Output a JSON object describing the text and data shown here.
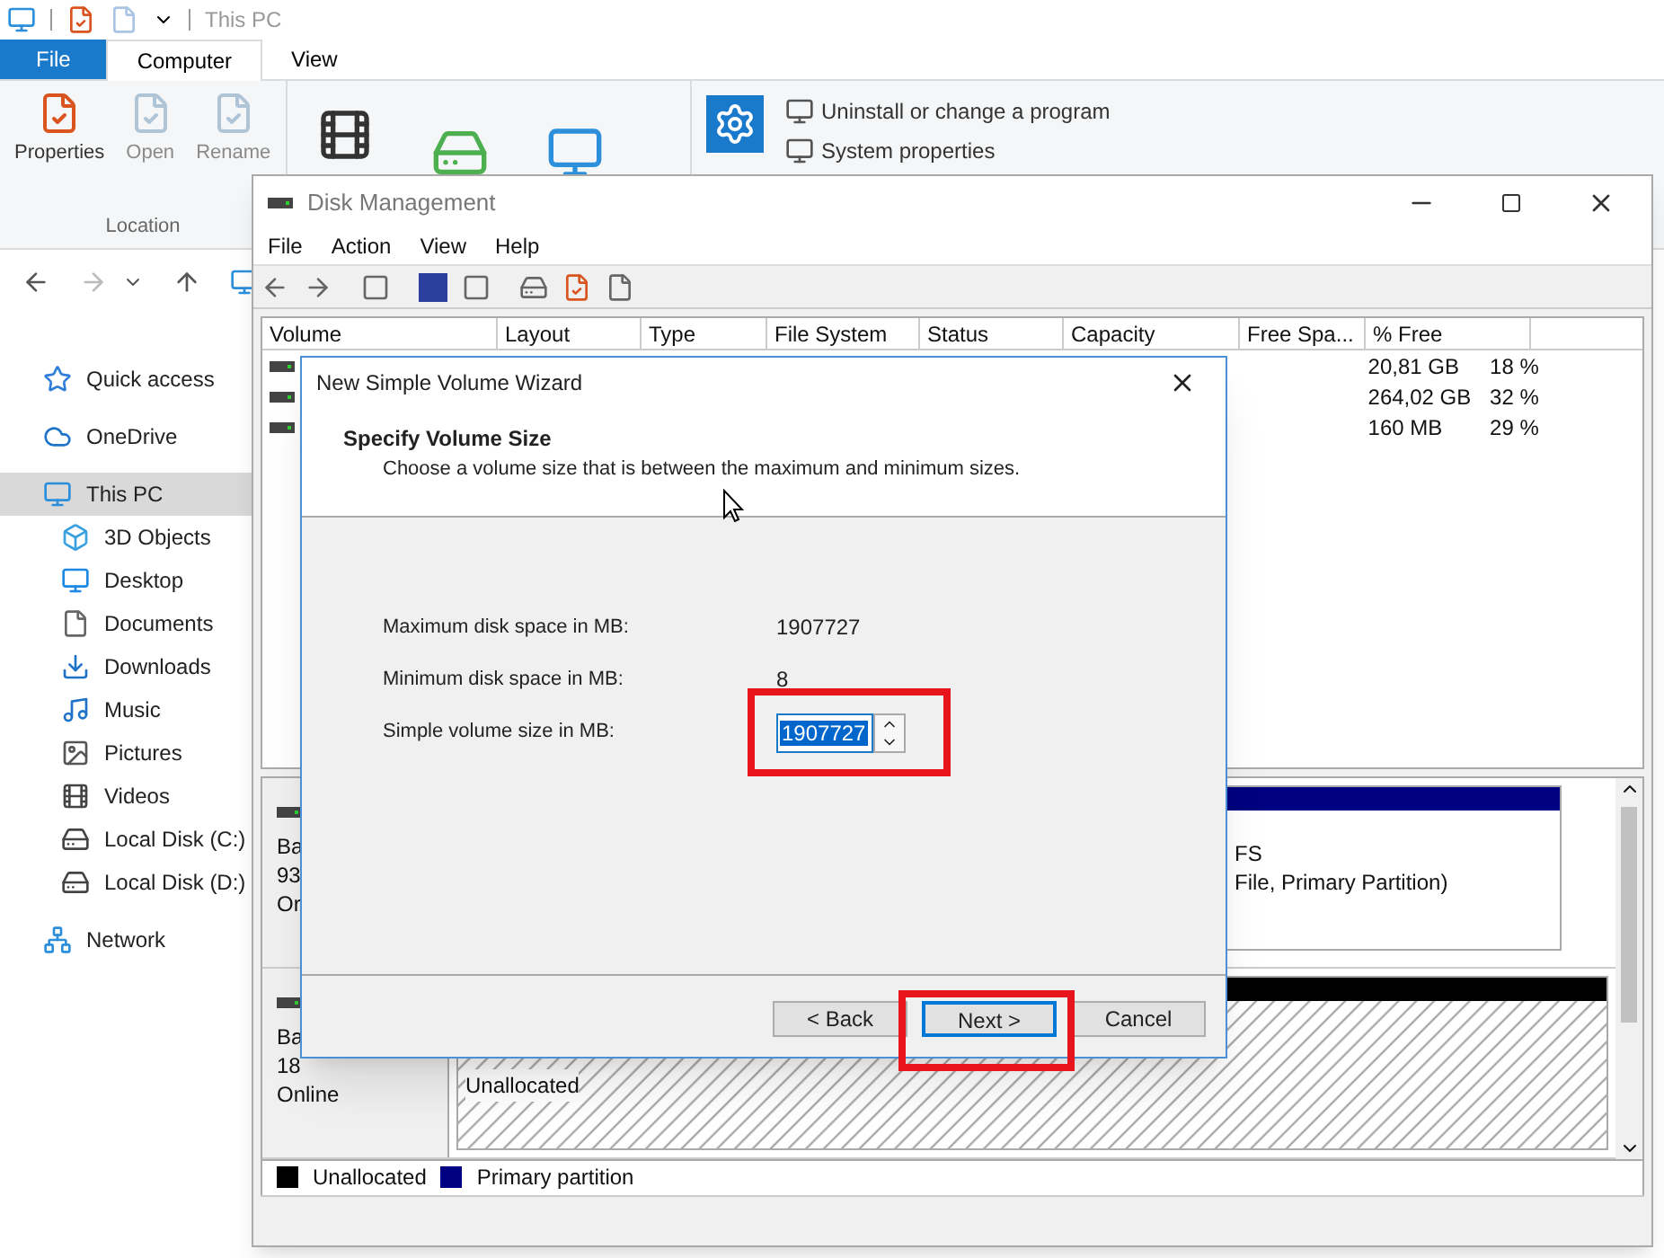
{
  "explorer": {
    "title": "This PC",
    "tabs": [
      {
        "label": "File",
        "kind": "file",
        "selected": false
      },
      {
        "label": "Computer",
        "kind": "tab",
        "selected": true
      },
      {
        "label": "View",
        "kind": "tab",
        "selected": false
      }
    ],
    "ribbon": {
      "location_items": [
        {
          "label": "Properties",
          "disabled": false
        },
        {
          "label": "Open",
          "disabled": true
        },
        {
          "label": "Rename",
          "disabled": true
        }
      ],
      "location_label": "Location",
      "system_links": [
        "Uninstall or change a program",
        "System properties"
      ]
    },
    "sidebar": [
      {
        "label": "Quick access",
        "selected": false
      },
      {
        "label": "OneDrive",
        "selected": false
      },
      {
        "label": "This PC",
        "selected": true,
        "children": [
          {
            "label": "3D Objects",
            "selected": false
          },
          {
            "label": "Desktop",
            "selected": false
          },
          {
            "label": "Documents",
            "selected": false
          },
          {
            "label": "Downloads",
            "selected": false
          },
          {
            "label": "Music",
            "selected": false
          },
          {
            "label": "Pictures",
            "selected": false
          },
          {
            "label": "Videos",
            "selected": false
          },
          {
            "label": "Local Disk (C:)",
            "selected": false
          },
          {
            "label": "Local Disk (D:)",
            "selected": false
          }
        ]
      },
      {
        "label": "Network",
        "selected": false
      }
    ]
  },
  "disk_management": {
    "title": "Disk Management",
    "menu": [
      "File",
      "Action",
      "View",
      "Help"
    ],
    "columns": [
      "Volume",
      "Layout",
      "Type",
      "File System",
      "Status",
      "Capacity",
      "Free Spa...",
      "% Free"
    ],
    "rows": [
      {
        "free_space": "20,81 GB",
        "percent_free": "18 %"
      },
      {
        "free_space": "264,02 GB",
        "percent_free": "32 %"
      },
      {
        "free_space": "160 MB",
        "percent_free": "29 %"
      }
    ],
    "disks": [
      {
        "info": [
          "Ba",
          "93",
          "Or"
        ],
        "partition_lines": [
          "FS",
          "File, Primary Partition)"
        ],
        "kind": "primary"
      },
      {
        "info": [
          "Ba",
          "18",
          "Online"
        ],
        "partition_lines": [
          "Unallocated"
        ],
        "kind": "unallocated"
      }
    ],
    "legend": [
      {
        "label": "Unallocated",
        "color": "#000000"
      },
      {
        "label": "Primary partition",
        "color": "#000080"
      }
    ]
  },
  "wizard": {
    "title": "New Simple Volume Wizard",
    "heading": "Specify Volume Size",
    "subtitle": "Choose a volume size that is between the maximum and minimum sizes.",
    "fields": [
      {
        "label": "Maximum disk space in MB:",
        "value": "1907727",
        "kind": "text"
      },
      {
        "label": "Minimum disk space in MB:",
        "value": "8",
        "kind": "text"
      },
      {
        "label": "Simple volume size in MB:",
        "value": "1907727",
        "kind": "spin",
        "highlighted": true
      }
    ],
    "buttons": [
      {
        "label": "< Back",
        "default": false
      },
      {
        "label": "Next >",
        "default": true
      },
      {
        "label": "Cancel",
        "default": false
      }
    ]
  }
}
